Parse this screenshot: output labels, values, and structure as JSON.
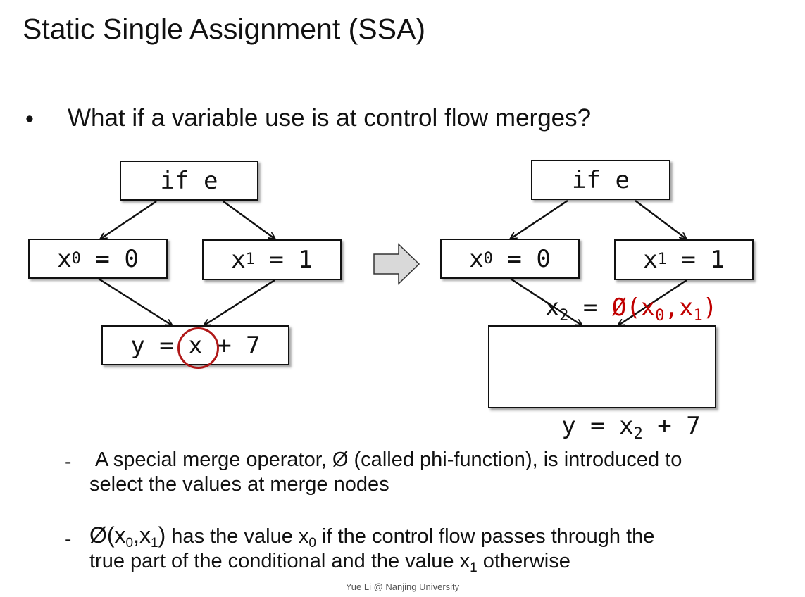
{
  "slide": {
    "title": "Static Single Assignment (SSA)",
    "bullet": "What if a variable use is at control flow merges?",
    "footer": "Yue Li @ Nanjing University"
  },
  "left_cfg": {
    "cond": "if e",
    "x0_var": "x",
    "x0_sub": "0",
    "x0_rhs": " = 0",
    "x1_var": "x",
    "x1_sub": "1",
    "x1_rhs": " = 1",
    "merge_lhs": "y = ",
    "merge_x": "x",
    "merge_rhs": " + 7"
  },
  "right_cfg": {
    "cond": "if e",
    "x0_var": "x",
    "x0_sub": "0",
    "x0_rhs": " = 0",
    "x1_var": "x",
    "x1_sub": "1",
    "x1_rhs": " = 1",
    "phi_lhs_var": "x",
    "phi_lhs_sub": "2",
    "phi_eq": " = ",
    "phi_open": "Ø(x",
    "phi_a_sub": "0",
    "phi_comma": ",x",
    "phi_b_sub": "1",
    "phi_close": ")",
    "y_lhs": "y = x",
    "y_sub": "2",
    "y_rhs": " + 7"
  },
  "notes": [
    {
      "dash": "-",
      "line1": "A special merge operator, Ø (called phi-function), is introduced to",
      "line2": "select the values at merge nodes"
    },
    {
      "dash": "-",
      "phi_prefix": "Ø(x",
      "phi_a_sub": "0",
      "phi_comma": ",x",
      "phi_b_sub": "1",
      "phi_close": ")",
      "mid1": " has the value x",
      "mid1_sub": "0",
      "mid2": " if the control flow passes through the",
      "line2a": "true part of the conditional and the value x",
      "line2_sub": "1",
      "line2b": " otherwise"
    }
  ],
  "colors": {
    "phi": "#c00000",
    "circle": "#b01818",
    "arrow_fill": "#d9d9d9"
  }
}
